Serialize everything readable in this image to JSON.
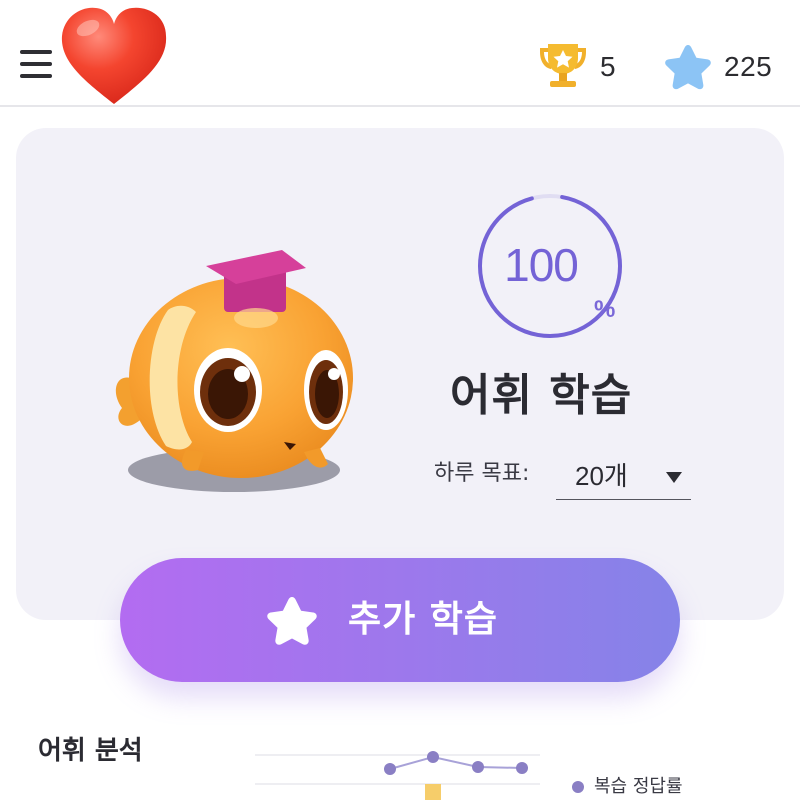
{
  "header": {
    "menu_icon": "hamburger-menu-icon",
    "heart_icon": "heart-icon",
    "trophy": {
      "icon": "trophy-icon",
      "count": "5",
      "color": "#f4b52a"
    },
    "stars": {
      "icon": "star-icon",
      "count": "225",
      "color": "#8cc4f5"
    }
  },
  "card": {
    "mascot_icon": "graduate-fish-mascot",
    "progress": {
      "value": "100",
      "unit": "%",
      "percent": 100,
      "color": "#7463d6"
    },
    "title": "어휘 학습",
    "daily_goal": {
      "label": "하루 목표:",
      "value": "20개"
    }
  },
  "cta": {
    "icon": "star-icon",
    "label": "추가 학습",
    "gradient": [
      "#b36cf1",
      "#8583e8"
    ]
  },
  "analysis": {
    "title": "어휘 분석",
    "legend": "복습 정답률",
    "legend_color": "#8a7fc4"
  }
}
